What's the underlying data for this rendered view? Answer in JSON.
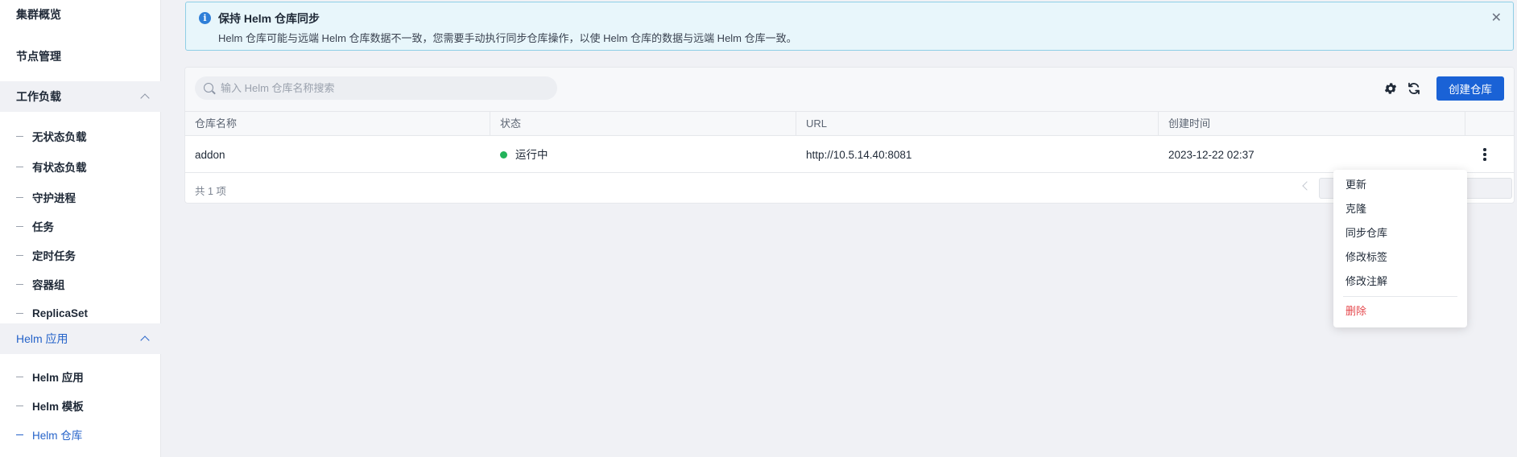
{
  "sidebar": {
    "top_items": [
      {
        "label": "集群概览"
      },
      {
        "label": "节点管理"
      }
    ],
    "groups": [
      {
        "label": "工作负载",
        "expanded": true,
        "items": [
          {
            "label": "无状态负载"
          },
          {
            "label": "有状态负载"
          },
          {
            "label": "守护进程"
          },
          {
            "label": "任务"
          },
          {
            "label": "定时任务"
          },
          {
            "label": "容器组"
          },
          {
            "label": "ReplicaSet"
          }
        ]
      },
      {
        "label": "Helm 应用",
        "expanded": true,
        "active": true,
        "items": [
          {
            "label": "Helm 应用"
          },
          {
            "label": "Helm 模板"
          },
          {
            "label": "Helm 仓库",
            "active": true
          }
        ]
      }
    ]
  },
  "alert": {
    "title": "保持 Helm 仓库同步",
    "description": "Helm 仓库可能与远端 Helm 仓库数据不一致，您需要手动执行同步仓库操作，以使 Helm 仓库的数据与远端 Helm 仓库一致。",
    "close_glyph": "✕",
    "info_glyph": "i"
  },
  "toolbar": {
    "search_placeholder": "输入 Helm 仓库名称搜索",
    "search_value": "",
    "create_label": "创建仓库"
  },
  "table": {
    "columns": [
      "仓库名称",
      "状态",
      "URL",
      "创建时间"
    ],
    "rows": [
      {
        "name": "addon",
        "status": "运行中",
        "status_color": "#22b35a",
        "url": "http://10.5.14.40:8081",
        "created": "2023-12-22 02:37"
      }
    ],
    "total_text": "共 1 项"
  },
  "row_menu": {
    "items": [
      "更新",
      "克隆",
      "同步仓库",
      "修改标签",
      "修改注解"
    ],
    "danger_item": "删除"
  },
  "colors": {
    "primary": "#1a62d6",
    "active_nav": "#2563c9",
    "danger": "#e5484d",
    "alert_bg": "#e8f6fb"
  }
}
